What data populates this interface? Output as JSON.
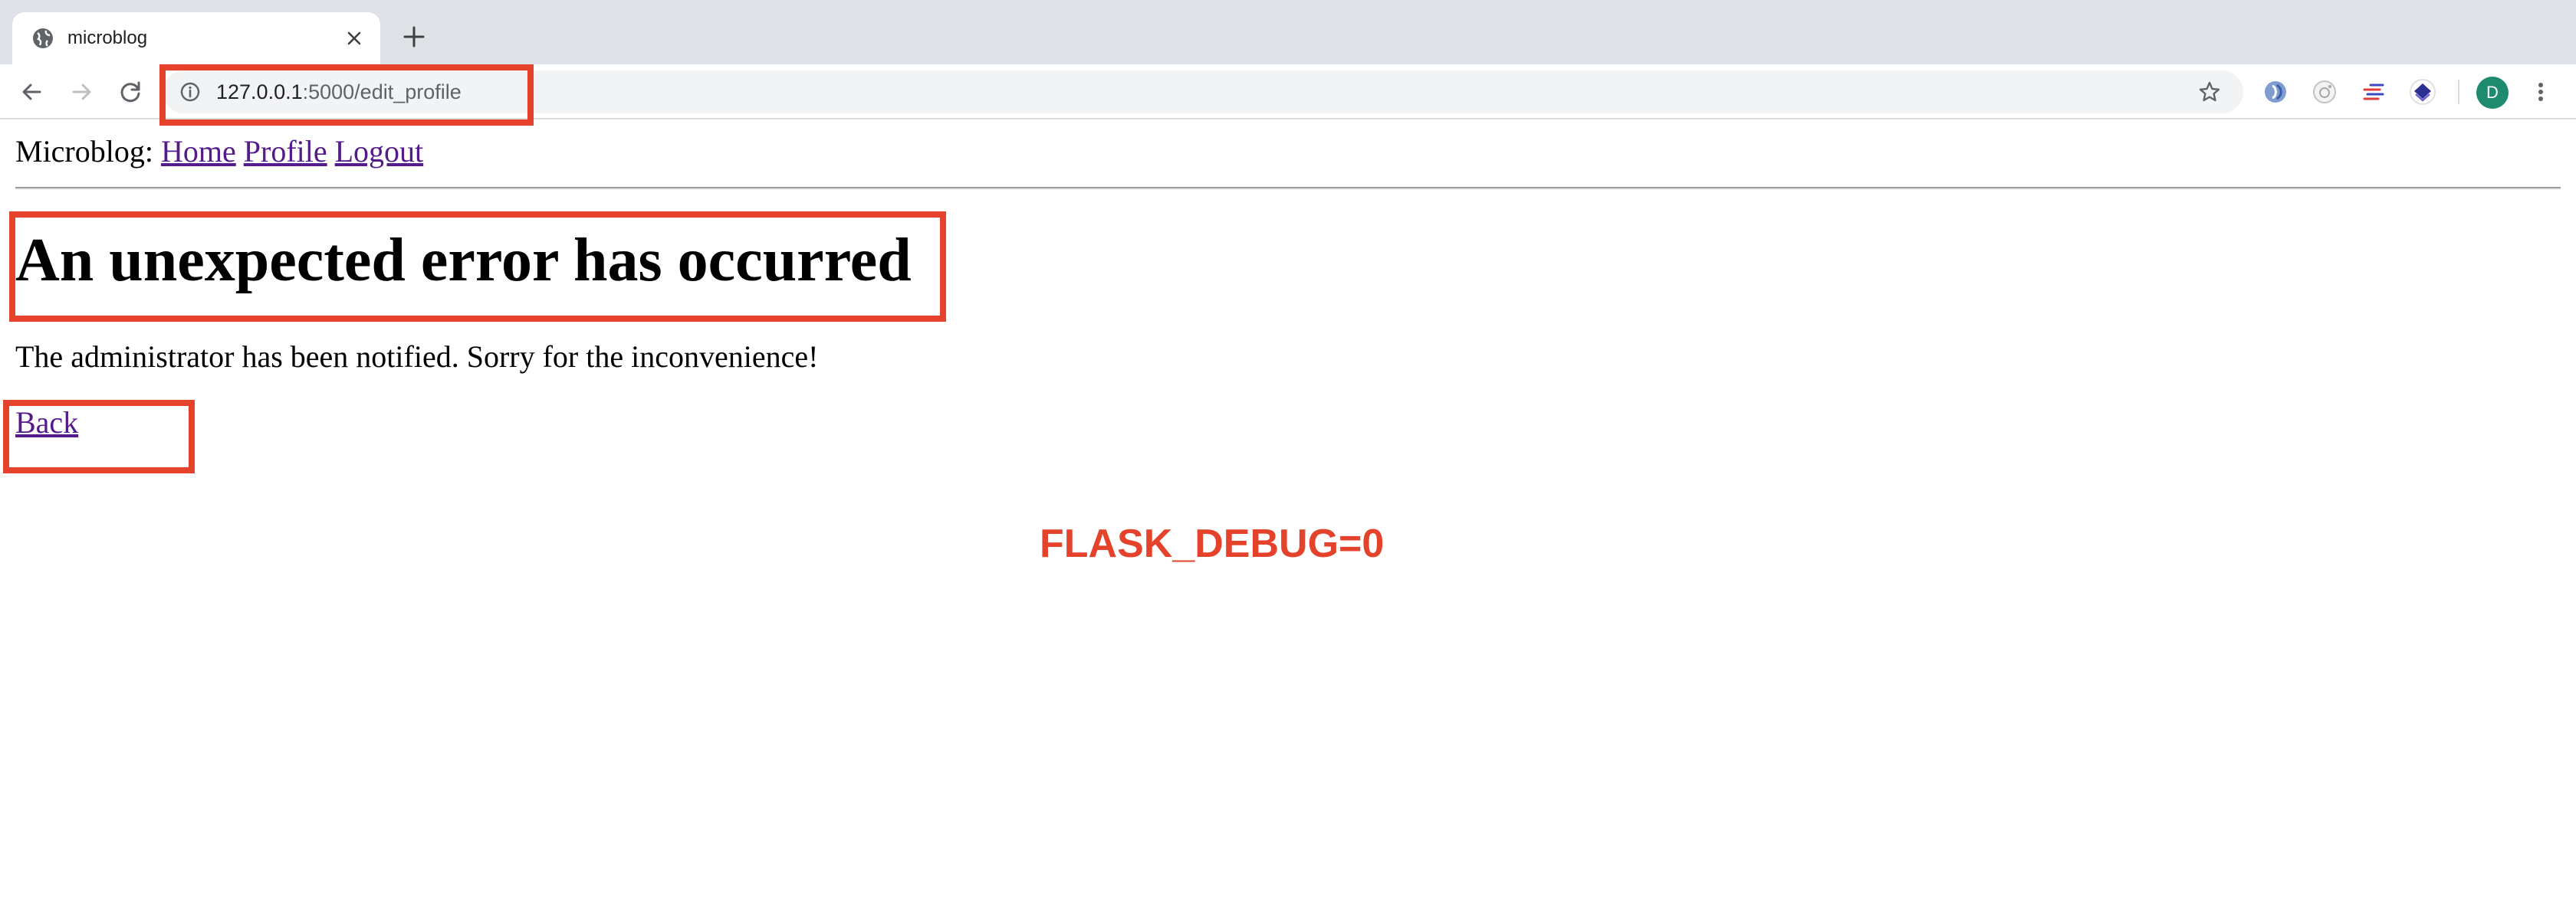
{
  "browser": {
    "tab": {
      "title": "microblog"
    },
    "address_bar": {
      "url_host": "127.0.0.1",
      "url_path": ":5000/edit_profile"
    },
    "profile_initial": "D"
  },
  "site_nav": {
    "brand": "Microblog:",
    "links": [
      "Home",
      "Profile",
      "Logout"
    ]
  },
  "main": {
    "title": "An unexpected error has occurred",
    "message": "The administrator has been notified. Sorry for the inconvenience!",
    "back_link": "Back"
  },
  "annotation": {
    "caption": "FLASK_DEBUG=0",
    "color": "#e5422b"
  },
  "colors": {
    "link_visited": "#551a8b",
    "chrome_tabstrip": "#dee1e6",
    "omnibox_bg": "#f1f3f4",
    "avatar_bg": "#1e8a6e"
  }
}
